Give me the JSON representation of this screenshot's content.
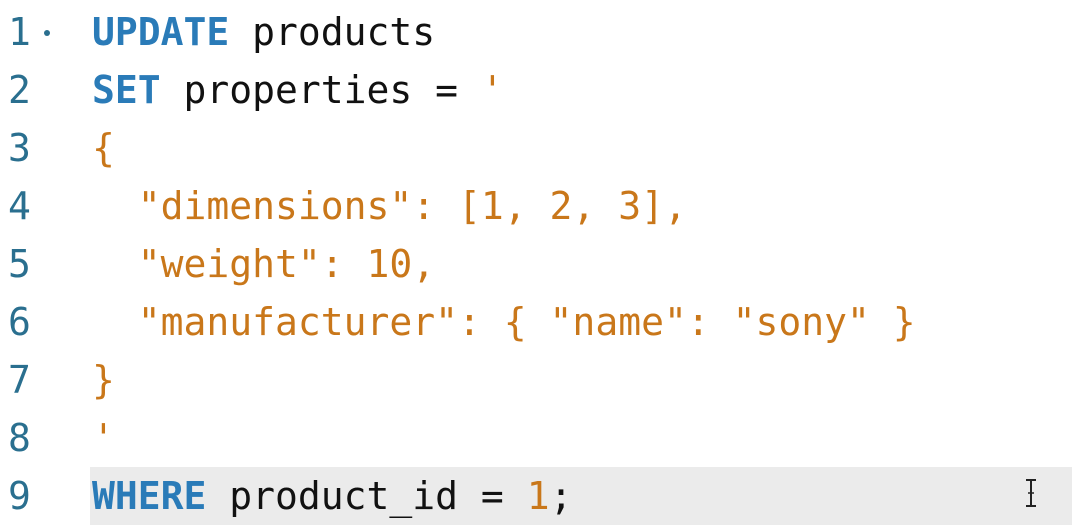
{
  "lines": [
    {
      "num": "1",
      "parts": [
        "UPDATE",
        " products"
      ]
    },
    {
      "num": "2",
      "parts": [
        "SET",
        " properties = ",
        "'"
      ]
    },
    {
      "num": "3",
      "parts": [
        "{"
      ]
    },
    {
      "num": "4",
      "parts": [
        "  \"dimensions\": [1, 2, 3],"
      ]
    },
    {
      "num": "5",
      "parts": [
        "  \"weight\": 10,"
      ]
    },
    {
      "num": "6",
      "parts": [
        "  \"manufacturer\": { \"name\": \"sony\" }"
      ]
    },
    {
      "num": "7",
      "parts": [
        "}"
      ]
    },
    {
      "num": "8",
      "parts": [
        "'"
      ]
    },
    {
      "num": "9",
      "parts": [
        "WHERE",
        " product_id = ",
        "1",
        ";"
      ]
    }
  ],
  "colors": {
    "keyword": "#2a7bb8",
    "string": "#c9771a",
    "line_number": "#2a6f8f",
    "current_line": "#ebebeb"
  },
  "icons": {
    "fold_marker": "fold-dot-icon",
    "cursor": "text-cursor-icon"
  }
}
